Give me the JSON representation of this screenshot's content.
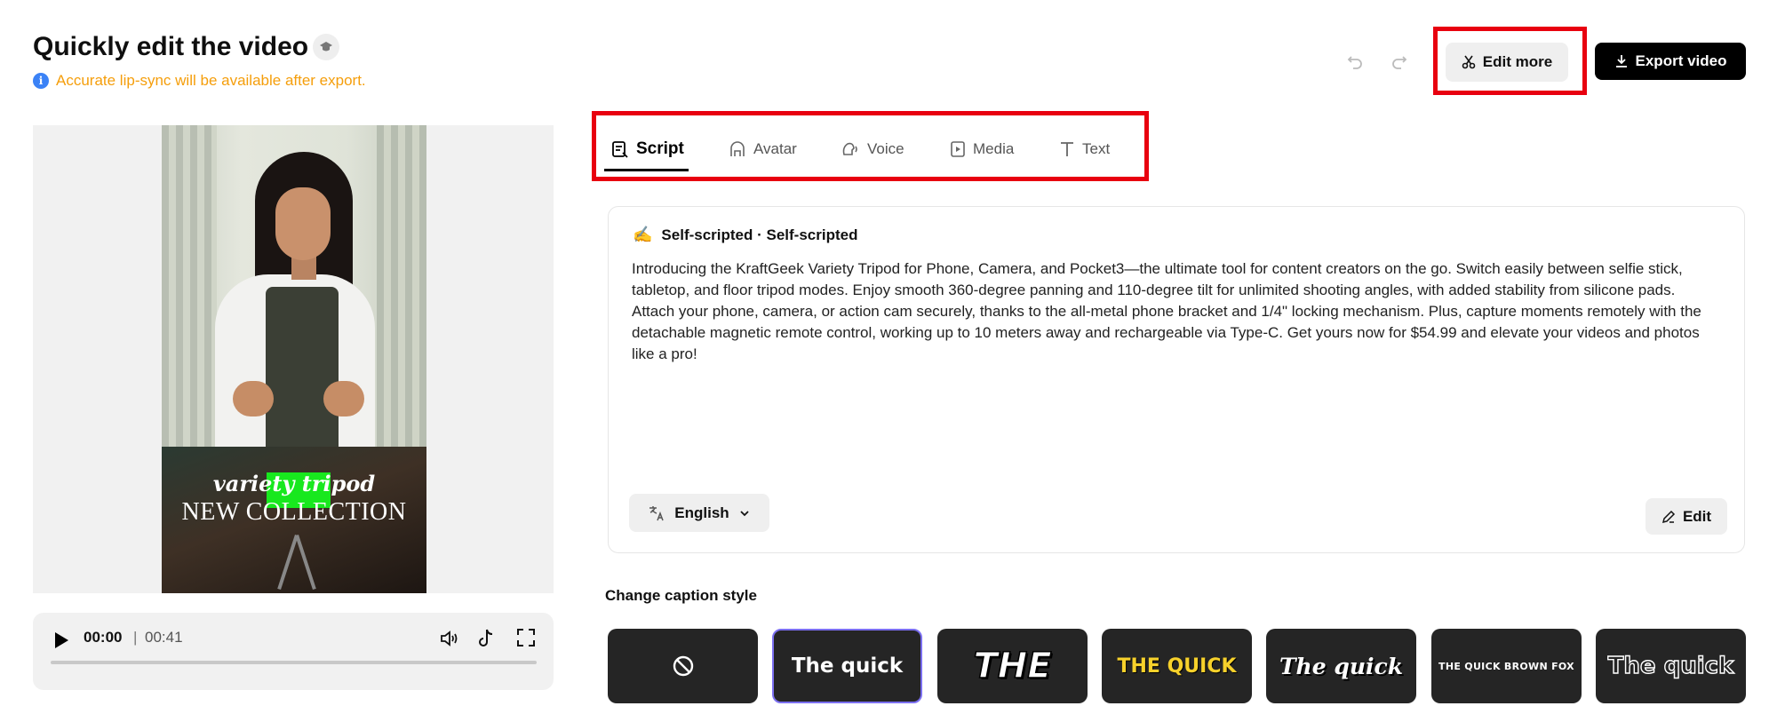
{
  "header": {
    "title": "Quickly edit the video",
    "notice": "Accurate lip-sync will be available after export.",
    "edit_more_label": "Edit more",
    "export_label": "Export video"
  },
  "player": {
    "caption_line1": "variety tripod",
    "caption_line2": "NEW COLLECTION",
    "current_time": "00:00",
    "separator": "|",
    "total_time": "00:41",
    "progress": 0
  },
  "tabs": [
    {
      "label": "Script",
      "icon": "script-icon",
      "active": true
    },
    {
      "label": "Avatar",
      "icon": "avatar-icon",
      "active": false
    },
    {
      "label": "Voice",
      "icon": "voice-icon",
      "active": false
    },
    {
      "label": "Media",
      "icon": "media-icon",
      "active": false
    },
    {
      "label": "Text",
      "icon": "text-icon",
      "active": false
    }
  ],
  "script": {
    "header": "Self-scripted · Self-scripted",
    "body": "Introducing the KraftGeek Variety Tripod for Phone, Camera, and Pocket3—the ultimate tool for content creators on the go. Switch easily between selfie stick, tabletop, and floor tripod modes. Enjoy smooth 360-degree panning and 110-degree tilt for unlimited shooting angles, with added stability from silicone pads. Attach your phone, camera, or action cam securely, thanks to the all-metal phone bracket and 1/4\" locking mechanism. Plus, capture moments remotely with the detachable magnetic remote control, working up to 10 meters away and rechargeable via Type-C. Get yours now for $54.99 and elevate your videos and photos like a pro!",
    "language": "English",
    "edit_label": "Edit"
  },
  "caption_styles": {
    "title": "Change caption style",
    "items": [
      {
        "label": "",
        "kind": "none"
      },
      {
        "label": "The quick",
        "kind": "bold",
        "selected": true
      },
      {
        "label": "THE",
        "kind": "italic-outline"
      },
      {
        "label": "THE QUICK",
        "kind": "yellow"
      },
      {
        "label": "The quick",
        "kind": "script"
      },
      {
        "label": "THE QUICK BROWN FOX",
        "kind": "small-caps-highlight"
      },
      {
        "label": "The quick",
        "kind": "outline"
      }
    ]
  },
  "colors": {
    "highlight_red": "#e8000f",
    "notice_orange": "#f59e0b",
    "info_blue": "#3b82f6",
    "selected_border": "#7b6ff0"
  }
}
